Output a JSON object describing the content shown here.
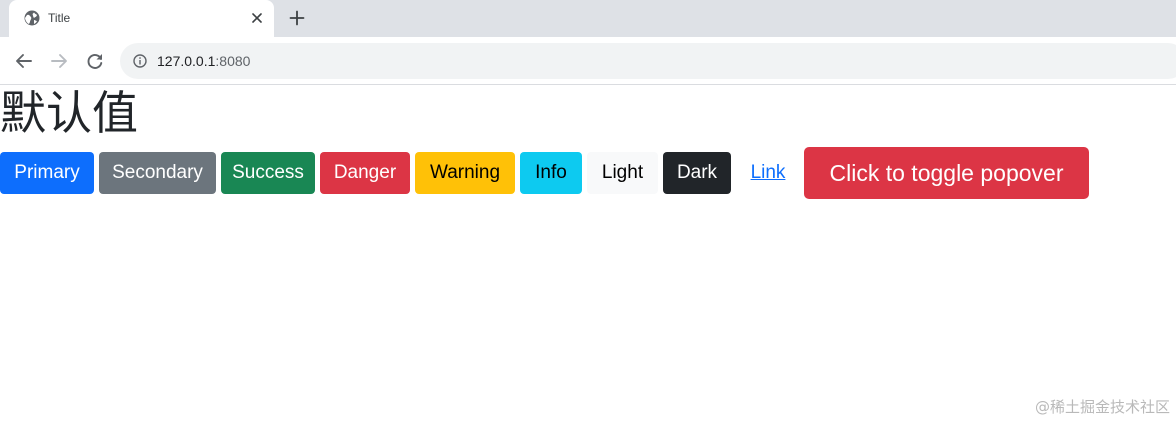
{
  "browser": {
    "tab": {
      "title": "Title",
      "favicon": "globe-icon",
      "close_icon": "close-icon"
    },
    "new_tab_icon": "plus-icon",
    "nav": {
      "back_icon": "arrow-left-icon",
      "forward_icon": "arrow-right-icon",
      "reload_icon": "reload-icon"
    },
    "address": {
      "info_icon": "info-icon",
      "host": "127.0.0.1",
      "port": ":8080"
    }
  },
  "page": {
    "heading": "默认值",
    "buttons": {
      "primary": "Primary",
      "secondary": "Secondary",
      "success": "Success",
      "danger": "Danger",
      "warning": "Warning",
      "info": "Info",
      "light": "Light",
      "dark": "Dark",
      "link": "Link"
    },
    "popover_button": "Click to toggle popover"
  },
  "colors": {
    "primary": "#0d6efd",
    "secondary": "#6c757d",
    "success": "#198754",
    "danger": "#dc3545",
    "warning": "#ffc107",
    "info": "#0dcaf0",
    "light": "#f8f9fa",
    "dark": "#212529"
  },
  "watermark": "@稀土掘金技术社区"
}
